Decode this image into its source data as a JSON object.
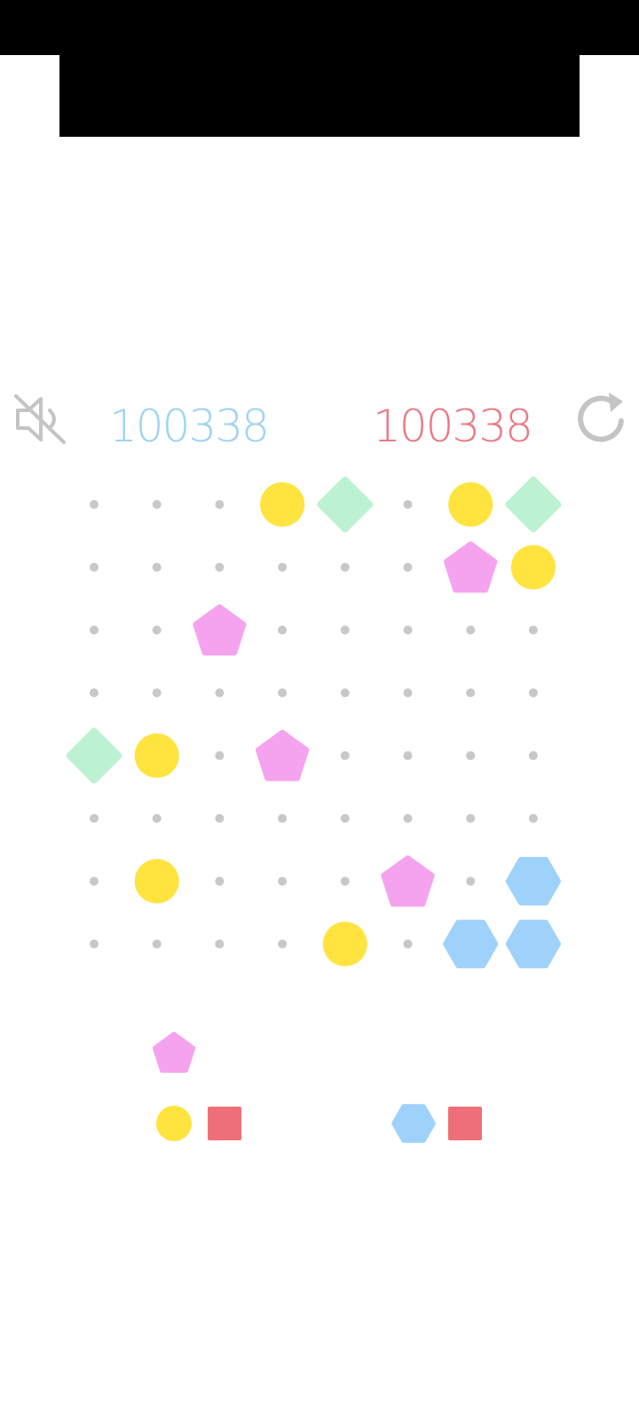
{
  "score": {
    "current": "100338",
    "best": "100338"
  },
  "icons": {
    "mute": "speaker-muted-icon",
    "restart": "restart-icon"
  },
  "colors": {
    "yellow": "#ffe33f",
    "green": "#bcf2d3",
    "pink": "#f6a3ef",
    "blue": "#9ed2fb",
    "red": "#ef6f79",
    "empty_dot": "#c8c8c8",
    "score_current": "#9ed2f4",
    "score_best": "#ec7883",
    "icon_gray": "#c4c4c4"
  },
  "board": {
    "rows": 8,
    "cols": 8,
    "pieces": [
      {
        "row": 0,
        "col": 3,
        "shape": "circle",
        "color": "yellow"
      },
      {
        "row": 0,
        "col": 4,
        "shape": "diamond",
        "color": "green"
      },
      {
        "row": 0,
        "col": 6,
        "shape": "circle",
        "color": "yellow"
      },
      {
        "row": 0,
        "col": 7,
        "shape": "diamond",
        "color": "green"
      },
      {
        "row": 1,
        "col": 6,
        "shape": "pentagon",
        "color": "pink"
      },
      {
        "row": 1,
        "col": 7,
        "shape": "circle",
        "color": "yellow"
      },
      {
        "row": 2,
        "col": 2,
        "shape": "pentagon",
        "color": "pink"
      },
      {
        "row": 4,
        "col": 0,
        "shape": "diamond",
        "color": "green"
      },
      {
        "row": 4,
        "col": 1,
        "shape": "circle",
        "color": "yellow"
      },
      {
        "row": 4,
        "col": 3,
        "shape": "pentagon",
        "color": "pink"
      },
      {
        "row": 6,
        "col": 1,
        "shape": "circle",
        "color": "yellow"
      },
      {
        "row": 6,
        "col": 5,
        "shape": "pentagon",
        "color": "pink"
      },
      {
        "row": 6,
        "col": 7,
        "shape": "hexagon",
        "color": "blue"
      },
      {
        "row": 7,
        "col": 4,
        "shape": "circle",
        "color": "yellow"
      },
      {
        "row": 7,
        "col": 6,
        "shape": "hexagon",
        "color": "blue"
      },
      {
        "row": 7,
        "col": 7,
        "shape": "hexagon",
        "color": "blue"
      }
    ]
  },
  "next_pieces": {
    "left": [
      {
        "shape": "pentagon",
        "color": "pink"
      },
      {
        "shape": "circle",
        "color": "yellow"
      },
      {
        "shape": "square",
        "color": "red"
      }
    ],
    "right": [
      {
        "shape": "hexagon",
        "color": "blue"
      },
      {
        "shape": "square",
        "color": "red"
      }
    ]
  }
}
